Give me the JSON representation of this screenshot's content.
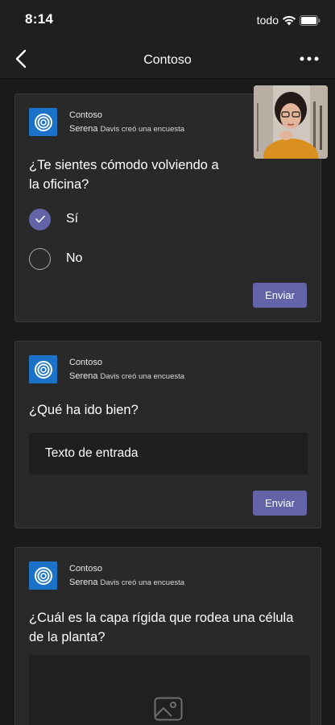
{
  "status_bar": {
    "time": "8:14",
    "carrier": "todo",
    "wifi_icon": "wifi-icon",
    "battery_icon": "battery-icon"
  },
  "nav": {
    "title": "Contoso",
    "back_icon": "chevron-left-icon",
    "more_icon": "more-horizontal-icon"
  },
  "colors": {
    "accent": "#6264a7",
    "app_logo": "#1a73c9",
    "background": "#1f1f1f",
    "card": "#292929"
  },
  "cards": [
    {
      "app_name": "Contoso",
      "sender": "Serena",
      "action": "Davis creó una encuesta",
      "question": "¿Te sientes cómodo volviendo a la oficina?",
      "options": [
        {
          "label": "Sí",
          "selected": true
        },
        {
          "label": "No",
          "selected": false
        }
      ],
      "submit_label": "Enviar"
    },
    {
      "app_name": "Contoso",
      "sender": "Serena",
      "action": "Davis creó una encuesta",
      "question": "¿Qué ha ido bien?",
      "input_placeholder": "Texto de entrada",
      "submit_label": "Enviar"
    },
    {
      "app_name": "Contoso",
      "sender": "Serena",
      "action": "Davis creó una encuesta",
      "question": "¿Cuál es la capa rígida que rodea una célula de la planta?",
      "image_icon": "image-icon"
    }
  ]
}
